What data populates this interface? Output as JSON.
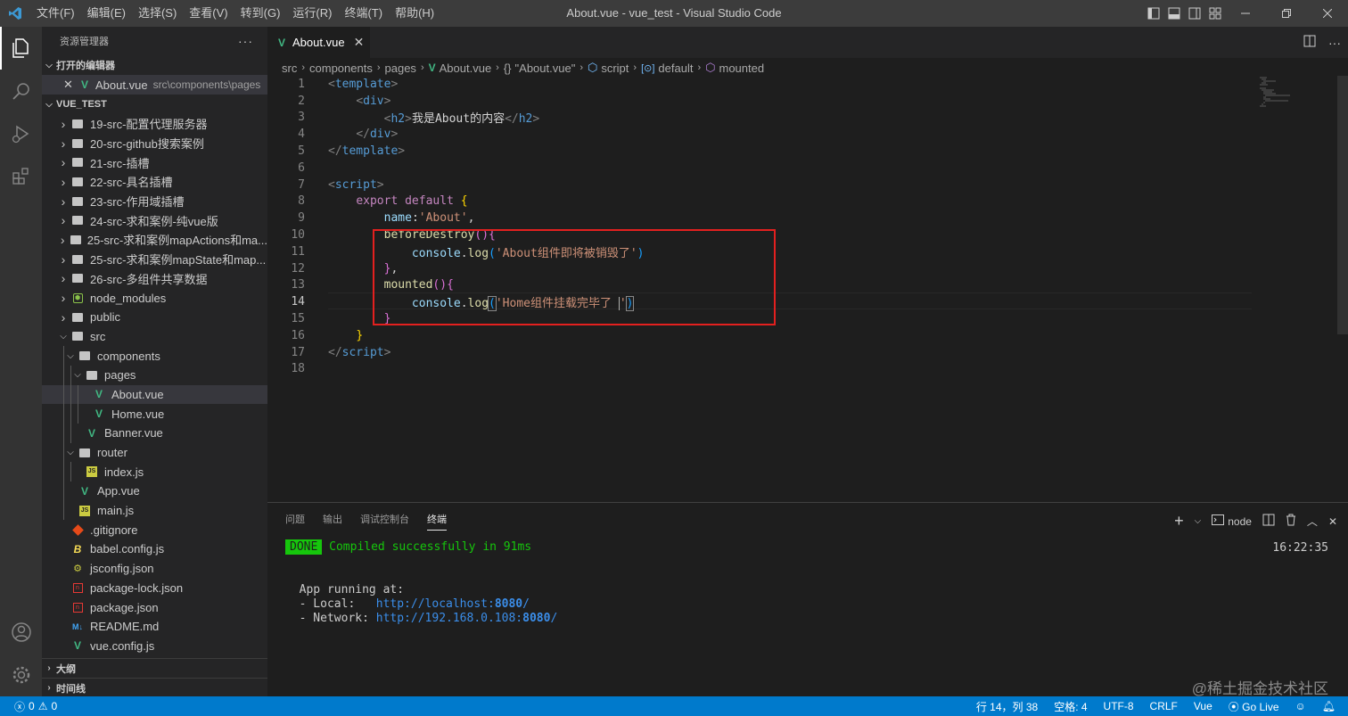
{
  "window": {
    "title": "About.vue - vue_test - Visual Studio Code"
  },
  "menu": [
    "文件(F)",
    "编辑(E)",
    "选择(S)",
    "查看(V)",
    "转到(G)",
    "运行(R)",
    "终端(T)",
    "帮助(H)"
  ],
  "sidebar": {
    "header": "资源管理器",
    "open_editors_label": "打开的编辑器",
    "open_editor": {
      "name": "About.vue",
      "path": "src\\components\\pages"
    },
    "project_label": "VUE_TEST",
    "tree": [
      {
        "name": "19-src-配置代理服务器",
        "type": "folder"
      },
      {
        "name": "20-src-github搜索案例",
        "type": "folder"
      },
      {
        "name": "21-src-插槽",
        "type": "folder"
      },
      {
        "name": "22-src-具名插槽",
        "type": "folder"
      },
      {
        "name": "23-src-作用域插槽",
        "type": "folder"
      },
      {
        "name": "24-src-求和案例-纯vue版",
        "type": "folder"
      },
      {
        "name": "25-src-求和案例mapActions和ma...",
        "type": "folder"
      },
      {
        "name": "25-src-求和案例mapState和map...",
        "type": "folder"
      },
      {
        "name": "26-src-多组件共享数据",
        "type": "folder"
      },
      {
        "name": "node_modules",
        "type": "node"
      },
      {
        "name": "public",
        "type": "folder"
      },
      {
        "name": "src",
        "type": "folder-open"
      },
      {
        "name": "components",
        "type": "folder-open"
      },
      {
        "name": "pages",
        "type": "folder-open"
      },
      {
        "name": "About.vue",
        "type": "vue"
      },
      {
        "name": "Home.vue",
        "type": "vue"
      },
      {
        "name": "Banner.vue",
        "type": "vue"
      },
      {
        "name": "router",
        "type": "folder-open"
      },
      {
        "name": "index.js",
        "type": "js"
      },
      {
        "name": "App.vue",
        "type": "vue"
      },
      {
        "name": "main.js",
        "type": "js"
      },
      {
        "name": ".gitignore",
        "type": "git"
      },
      {
        "name": "babel.config.js",
        "type": "babel"
      },
      {
        "name": "jsconfig.json",
        "type": "json"
      },
      {
        "name": "package-lock.json",
        "type": "pkg"
      },
      {
        "name": "package.json",
        "type": "pkg"
      },
      {
        "name": "README.md",
        "type": "md"
      },
      {
        "name": "vue.config.js",
        "type": "vue"
      }
    ],
    "outline_label": "大纲",
    "timeline_label": "时间线"
  },
  "tab": {
    "label": "About.vue"
  },
  "breadcrumb": {
    "src": "src",
    "components": "components",
    "pages": "pages",
    "file": "About.vue",
    "obj": "\"About.vue\"",
    "script": "script",
    "default": "default",
    "mounted": "mounted"
  },
  "code": {
    "l1": "template",
    "l2": "div",
    "l3a": "h2",
    "l3b": "我是About的内容",
    "l3c": "h2",
    "l4": "div",
    "l5": "template",
    "l7": "script",
    "export": "export",
    "default": "default",
    "name_key": "name",
    "name_val": "'About'",
    "before_destroy": "beforeDestroy",
    "console": "console",
    "log": "log",
    "msg1": "'About组件即将被销毁了'",
    "mounted": "mounted",
    "msg2a": "'Home组件挂载完毕了 ",
    "msg2b": "'",
    "l17": "script"
  },
  "panel": {
    "tabs": [
      "问题",
      "输出",
      "调试控制台",
      "终端"
    ],
    "shell": "node",
    "done": "DONE",
    "compiled": "Compiled successfully in 91ms",
    "time": "16:22:35",
    "running": "App running at:",
    "local_label": "- Local:   ",
    "local_url_a": "http://localhost:",
    "local_port": "8080",
    "local_url_b": "/",
    "network_label": "- Network: ",
    "net_url_a": "http://192.168.0.108:",
    "net_port": "8080",
    "net_url_b": "/"
  },
  "status": {
    "errors": "0",
    "warnings": "0",
    "position": "行 14，列 38",
    "spaces": "空格: 4",
    "encoding": "UTF-8",
    "eol": "CRLF",
    "lang": "Vue",
    "golive": "Go Live"
  },
  "watermark": "@稀土掘金技术社区",
  "colors": {
    "accent": "#007acc",
    "highlight_box": "#e3201f",
    "vue_green": "#41b883"
  }
}
